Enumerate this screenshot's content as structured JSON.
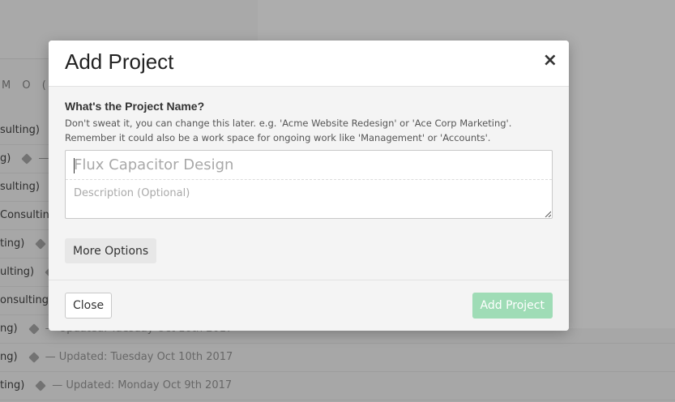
{
  "background": {
    "days": [
      "M",
      "O",
      "("
    ],
    "rows": [
      {
        "project": "sulting)",
        "updated": ""
      },
      {
        "project": "g)",
        "updated": "—"
      },
      {
        "project": "sulting)",
        "updated": ""
      },
      {
        "project": "Consulting)",
        "updated": ""
      },
      {
        "project": "ting)",
        "updated": ""
      },
      {
        "project": "ulting)",
        "updated": ""
      },
      {
        "project": "onsulting)",
        "updated": ""
      },
      {
        "project": "ng)",
        "updated": "— Updated: Tuesday Oct 10th 2017"
      },
      {
        "project": "ng)",
        "updated": "— Updated: Tuesday Oct 10th 2017"
      },
      {
        "project": "ting)",
        "updated": "— Updated: Monday Oct 9th 2017"
      }
    ]
  },
  "modal": {
    "title": "Add Project",
    "close_icon": "×",
    "field_label": "What's the Project Name?",
    "help_line1": "Don't sweat it, you can change this later. e.g. 'Acme Website Redesign' or 'Ace Corp Marketing'.",
    "help_line2": "Remember it could also be a work space for ongoing work like 'Management' or 'Accounts'.",
    "name_placeholder": "Flux Capacitor Design",
    "name_value": "",
    "description_placeholder": "Description (Optional)",
    "description_value": "",
    "more_options_label": "More Options",
    "close_label": "Close",
    "add_label": "Add Project"
  },
  "colors": {
    "add_button": "#9fdcb6",
    "overlay": "rgba(0,0,0,0.32)"
  }
}
